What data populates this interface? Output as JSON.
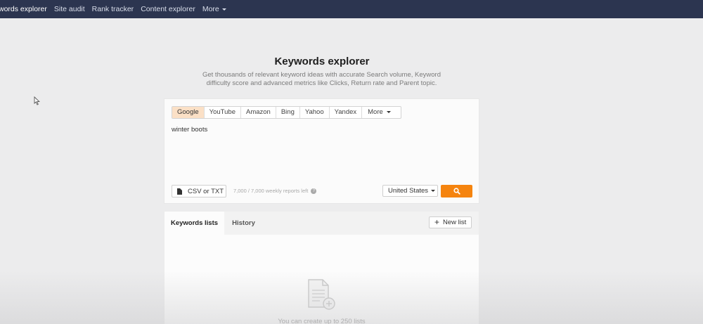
{
  "topnav": {
    "items": [
      "words explorer",
      "Site audit",
      "Rank tracker",
      "Content explorer",
      "More"
    ]
  },
  "header": {
    "title": "Keywords explorer",
    "subtitle": "Get thousands of relevant keyword ideas with accurate Search volume, Keyword difficulty score and advanced metrics like Clicks, Return rate and Parent topic."
  },
  "search": {
    "engines": [
      "Google",
      "YouTube",
      "Amazon",
      "Bing",
      "Yahoo",
      "Yandex"
    ],
    "more_label": "More",
    "active_engine": "Google",
    "keywords_value": "winter boots",
    "csv_label": "CSV or TXT",
    "reports_left": "7,000 / 7,000 weekly reports left",
    "country": "United States",
    "search_icon": "search-icon"
  },
  "lists": {
    "tab_lists": "Keywords lists",
    "tab_history": "History",
    "new_list_label": "New list",
    "empty_text": "You can create up to 250 lists"
  },
  "colors": {
    "nav_bg": "#2c3550",
    "accent": "#f5840f",
    "active_engine_bg": "#fbe0c6"
  }
}
